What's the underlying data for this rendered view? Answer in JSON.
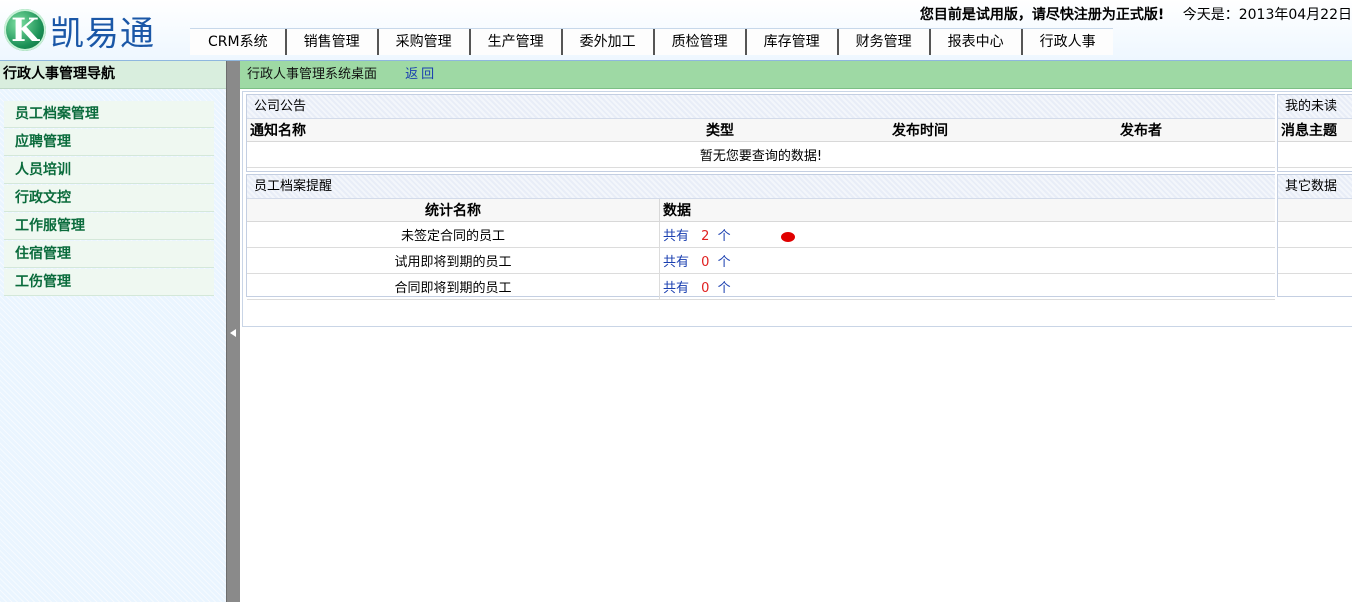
{
  "header": {
    "logo_letter": "K",
    "logo_text": "凯易通",
    "trial_notice": "您目前是试用版，请尽快注册为正式版!",
    "today_label": "今天是：",
    "today_date": "2013年04月22日"
  },
  "nav": [
    "CRM系统",
    "销售管理",
    "采购管理",
    "生产管理",
    "委外加工",
    "质检管理",
    "库存管理",
    "财务管理",
    "报表中心",
    "行政人事"
  ],
  "sidebar": {
    "title": "行政人事管理导航",
    "items": [
      "员工档案管理",
      "应聘管理",
      "人员培训",
      "行政文控",
      "工作服管理",
      "住宿管理",
      "工伤管理"
    ]
  },
  "main": {
    "title": "行政人事管理系统桌面",
    "back": "返回"
  },
  "announcements": {
    "title": "公司公告",
    "columns": [
      "通知名称",
      "类型",
      "发布时间",
      "发布者"
    ],
    "empty_text": "暂无您要查询的数据!"
  },
  "unread": {
    "title": "我的未读",
    "columns": [
      "消息主题"
    ]
  },
  "reminders": {
    "title": "员工档案提醒",
    "columns": [
      "统计名称",
      "数据"
    ],
    "rows": [
      {
        "name": "未签定合同的员工",
        "prefix": "共有",
        "count": "2",
        "unit": "个",
        "alert": true
      },
      {
        "name": "试用即将到期的员工",
        "prefix": "共有",
        "count": "0",
        "unit": "个",
        "alert": false
      },
      {
        "name": "合同即将到期的员工",
        "prefix": "共有",
        "count": "0",
        "unit": "个",
        "alert": false
      }
    ]
  },
  "other": {
    "title": "其它数据"
  },
  "colors": {
    "green_bar": "#9ed9a4",
    "link_blue": "#1a3fb0",
    "alert_red": "#e00000"
  }
}
